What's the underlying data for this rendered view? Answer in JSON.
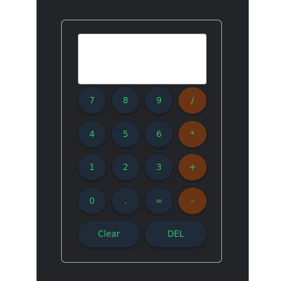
{
  "display": {
    "value": ""
  },
  "keypad": {
    "rows": [
      [
        {
          "label": "7"
        },
        {
          "label": "8"
        },
        {
          "label": "9"
        },
        {
          "label": "/"
        }
      ],
      [
        {
          "label": "4"
        },
        {
          "label": "5"
        },
        {
          "label": "6"
        },
        {
          "label": "*"
        }
      ],
      [
        {
          "label": "1"
        },
        {
          "label": "2"
        },
        {
          "label": "3"
        },
        {
          "label": "+"
        }
      ],
      [
        {
          "label": "0"
        },
        {
          "label": "."
        },
        {
          "label": "="
        },
        {
          "label": "-"
        }
      ]
    ],
    "clear_label": "Clear",
    "delete_label": "DEL"
  },
  "colors": {
    "app_background": "#222428",
    "key_background": "#1f2b38",
    "operator_key_background": "#6b3513",
    "key_text": "#36c26b",
    "display_background": "#ffffff",
    "frame_border": "#9ea2a8"
  }
}
